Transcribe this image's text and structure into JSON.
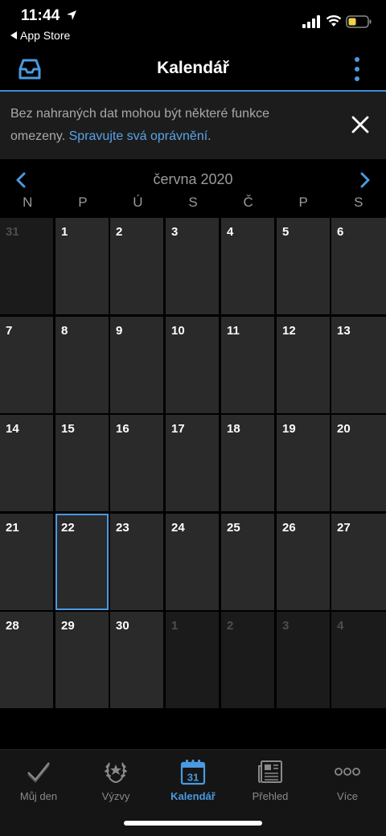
{
  "status": {
    "time": "11:44",
    "back_app": "App Store"
  },
  "nav": {
    "title": "Kalendář"
  },
  "banner": {
    "text": "Bez nahraných dat mohou být některé funkce omezeny. ",
    "link": "Spravujte svá oprávnění",
    "suffix": "."
  },
  "calendar": {
    "month": "června 2020",
    "weekdays": [
      "N",
      "P",
      "Ú",
      "S",
      "Č",
      "P",
      "S"
    ],
    "weeks": [
      [
        "31",
        "1",
        "2",
        "3",
        "4",
        "5",
        "6"
      ],
      [
        "7",
        "8",
        "9",
        "10",
        "11",
        "12",
        "13"
      ],
      [
        "14",
        "15",
        "16",
        "17",
        "18",
        "19",
        "20"
      ],
      [
        "21",
        "22",
        "23",
        "24",
        "25",
        "26",
        "27"
      ],
      [
        "28",
        "29",
        "30",
        "1",
        "2",
        "3",
        "4"
      ]
    ],
    "today": "22",
    "colors": {
      "accent": "#4a9ae0",
      "cell": "#2a2a2a",
      "cell_other": "#1b1b1b"
    }
  },
  "tabs": [
    {
      "label": "Můj den",
      "icon": "checkmark-icon"
    },
    {
      "label": "Výzvy",
      "icon": "laurel-icon"
    },
    {
      "label": "Kalendář",
      "icon": "calendar-icon",
      "active": true,
      "badge": "31"
    },
    {
      "label": "Přehled",
      "icon": "newspaper-icon"
    },
    {
      "label": "Více",
      "icon": "more-dots-icon"
    }
  ]
}
